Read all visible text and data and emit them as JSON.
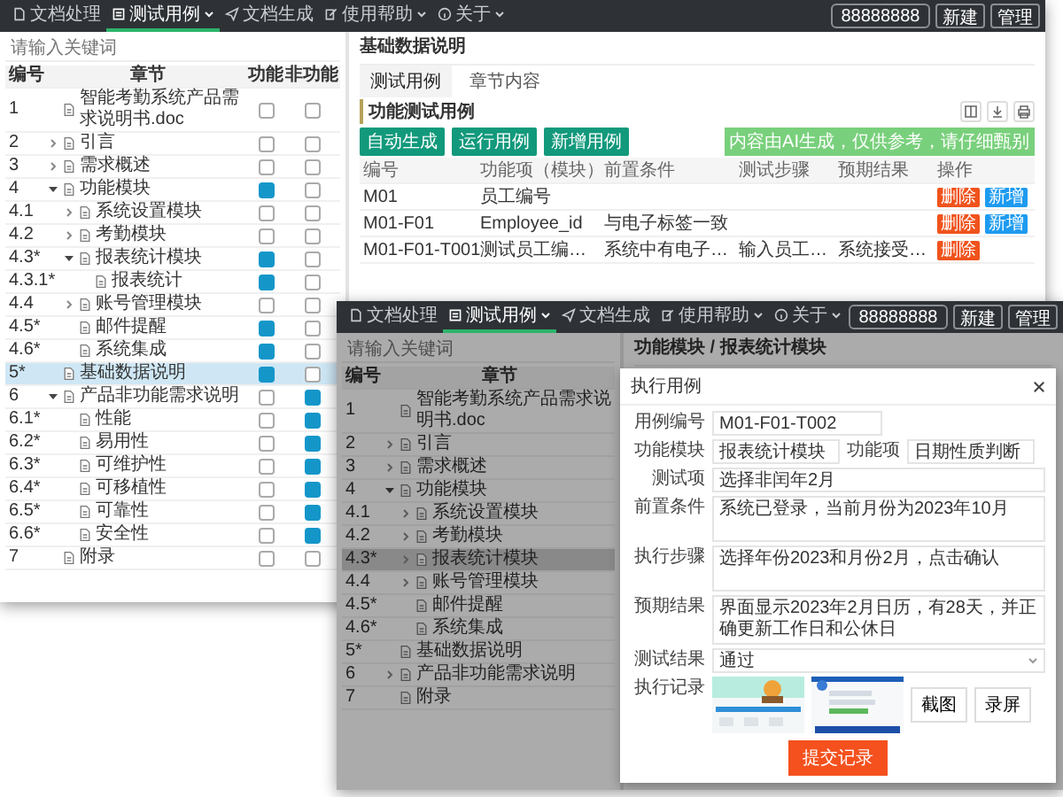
{
  "back_window": {
    "nav": {
      "items": [
        {
          "label": "文档处理",
          "selected": false,
          "has_menu": false
        },
        {
          "label": "测试用例",
          "selected": true,
          "has_menu": true
        },
        {
          "label": "文档生成",
          "selected": false,
          "has_menu": false
        },
        {
          "label": "使用帮助",
          "selected": false,
          "has_menu": true
        },
        {
          "label": "关于",
          "selected": false,
          "has_menu": true
        }
      ],
      "account": "88888888",
      "buttons": [
        "新建",
        "管理"
      ]
    },
    "tree": {
      "placeholder": "请输入关键词",
      "columns": [
        "编号",
        "章节",
        "功能",
        "非功能"
      ],
      "items": [
        {
          "number": "1",
          "title": "智能考勤系统产品需求说明书.doc",
          "selected": false,
          "functional": false,
          "nonfunctional": false
        },
        {
          "number": "2",
          "title": "引言",
          "expanded": false,
          "selected": false,
          "functional": false,
          "nonfunctional": false
        },
        {
          "number": "3",
          "title": "需求概述",
          "expanded": false,
          "selected": false,
          "functional": false,
          "nonfunctional": false
        },
        {
          "number": "4",
          "title": "功能模块",
          "expanded": true,
          "selected": false,
          "functional": true,
          "nonfunctional": false,
          "children": [
            {
              "number": "4.1",
              "title": "系统设置模块",
              "expanded": false,
              "selected": false,
              "functional": false,
              "nonfunctional": false
            },
            {
              "number": "4.2",
              "title": "考勤模块",
              "expanded": false,
              "selected": false,
              "functional": false,
              "nonfunctional": false
            },
            {
              "number": "4.3*",
              "title": "报表统计模块",
              "expanded": true,
              "selected": false,
              "functional": true,
              "nonfunctional": false,
              "children": [
                {
                  "number": "4.3.1*",
                  "title": "报表统计",
                  "selected": false,
                  "functional": true,
                  "nonfunctional": false
                }
              ]
            },
            {
              "number": "4.4",
              "title": "账号管理模块",
              "expanded": false,
              "selected": false,
              "functional": false,
              "nonfunctional": false
            },
            {
              "number": "4.5*",
              "title": "邮件提醒",
              "selected": false,
              "functional": true,
              "nonfunctional": false
            },
            {
              "number": "4.6*",
              "title": "系统集成",
              "selected": false,
              "functional": true,
              "nonfunctional": false
            }
          ]
        },
        {
          "number": "5*",
          "title": "基础数据说明",
          "selected": true,
          "functional": true,
          "nonfunctional": false
        },
        {
          "number": "6",
          "title": "产品非功能需求说明",
          "expanded": true,
          "selected": false,
          "functional": false,
          "nonfunctional": true,
          "children": [
            {
              "number": "6.1*",
              "title": "性能",
              "selected": false,
              "functional": false,
              "nonfunctional": true
            },
            {
              "number": "6.2*",
              "title": "易用性",
              "selected": false,
              "functional": false,
              "nonfunctional": true
            },
            {
              "number": "6.3*",
              "title": "可维护性",
              "selected": false,
              "functional": false,
              "nonfunctional": true
            },
            {
              "number": "6.4*",
              "title": "可移植性",
              "selected": false,
              "functional": false,
              "nonfunctional": true
            },
            {
              "number": "6.5*",
              "title": "可靠性",
              "selected": false,
              "functional": false,
              "nonfunctional": true
            },
            {
              "number": "6.6*",
              "title": "安全性",
              "selected": false,
              "functional": false,
              "nonfunctional": true
            }
          ]
        },
        {
          "number": "7",
          "title": "附录",
          "selected": false,
          "functional": false,
          "nonfunctional": false
        }
      ]
    },
    "detail": {
      "title": "基础数据说明",
      "tabs": [
        {
          "label": "测试用例",
          "selected": true
        },
        {
          "label": "章节内容",
          "selected": false
        }
      ],
      "heading": "功能测试用例",
      "actions": [
        "自动生成",
        "运行用例",
        "新增用例"
      ],
      "notice": "内容由AI生成，仅供参考，请仔细甄别",
      "columns": [
        "编号",
        "功能项（模块）",
        "前置条件",
        "测试步骤",
        "预期结果",
        "操作"
      ],
      "rows": [
        {
          "number": "M01",
          "item": "员工编号",
          "actions": [
            {
              "label": "删除",
              "kind": "delete"
            },
            {
              "label": "新增",
              "kind": "add"
            }
          ]
        },
        {
          "number": "M01-F01",
          "item": "Employee_id",
          "precondition": "与电子标签一致",
          "actions": [
            {
              "label": "删除",
              "kind": "delete"
            },
            {
              "label": "新增",
              "kind": "add"
            }
          ]
        },
        {
          "number": "M01-F01-T001",
          "item": "测试员工编…",
          "precondition": "系统中有电子…",
          "steps": "输入员工…",
          "expected": "系统接受…",
          "actions": [
            {
              "label": "删除",
              "kind": "delete"
            }
          ]
        }
      ]
    }
  },
  "front_window": {
    "nav": {
      "items": [
        {
          "label": "文档处理",
          "selected": false,
          "has_menu": false
        },
        {
          "label": "测试用例",
          "selected": true,
          "has_menu": true
        },
        {
          "label": "文档生成",
          "selected": false,
          "has_menu": false
        },
        {
          "label": "使用帮助",
          "selected": false,
          "has_menu": true
        },
        {
          "label": "关于",
          "selected": false,
          "has_menu": true
        }
      ],
      "account": "88888888",
      "buttons": [
        "新建",
        "管理"
      ]
    },
    "tree": {
      "placeholder": "请输入关键词",
      "columns": [
        "编号",
        "章节"
      ],
      "items": [
        {
          "number": "1",
          "title": "智能考勤系统产品需求说明书.doc",
          "selected": false
        },
        {
          "number": "2",
          "title": "引言",
          "expanded": false,
          "selected": false
        },
        {
          "number": "3",
          "title": "需求概述",
          "expanded": false,
          "selected": false
        },
        {
          "number": "4",
          "title": "功能模块",
          "expanded": true,
          "selected": false,
          "children": [
            {
              "number": "4.1",
              "title": "系统设置模块",
              "expanded": false,
              "selected": false
            },
            {
              "number": "4.2",
              "title": "考勤模块",
              "expanded": false,
              "selected": false
            },
            {
              "number": "4.3*",
              "title": "报表统计模块",
              "expanded": false,
              "selected": true
            },
            {
              "number": "4.4",
              "title": "账号管理模块",
              "expanded": false,
              "selected": false
            },
            {
              "number": "4.5*",
              "title": "邮件提醒",
              "selected": false
            },
            {
              "number": "4.6*",
              "title": "系统集成",
              "selected": false
            }
          ]
        },
        {
          "number": "5*",
          "title": "基础数据说明",
          "selected": false
        },
        {
          "number": "6",
          "title": "产品非功能需求说明",
          "expanded": false,
          "selected": false
        },
        {
          "number": "7",
          "title": "附录",
          "selected": false
        }
      ]
    },
    "detail": {
      "title": "功能模块 / 报表统计模块"
    }
  },
  "dialog": {
    "title": "执行用例",
    "case_id": {
      "label": "用例编号",
      "value": "M01-F01-T002"
    },
    "module": {
      "label": "功能模块",
      "value": "报表统计模块"
    },
    "item": {
      "label": "功能项",
      "value": "日期性质判断"
    },
    "test_item": {
      "label": "测试项",
      "value": "选择非闰年2月"
    },
    "precondition": {
      "label": "前置条件",
      "value": "系统已登录，当前月份为2023年10月"
    },
    "steps": {
      "label": "执行步骤",
      "value": "选择年份2023和月份2月，点击确认"
    },
    "expected": {
      "label": "预期结果",
      "value": "界面显示2023年2月日历，有28天，并正确更新工作日和公休日"
    },
    "result": {
      "label": "测试结果",
      "value": "通过"
    },
    "records": {
      "label": "执行记录",
      "attachments": [
        {
          "kind": "picture"
        },
        {
          "kind": "picture"
        }
      ],
      "buttons": [
        "截图",
        "录屏"
      ]
    },
    "submit": "提交记录"
  }
}
